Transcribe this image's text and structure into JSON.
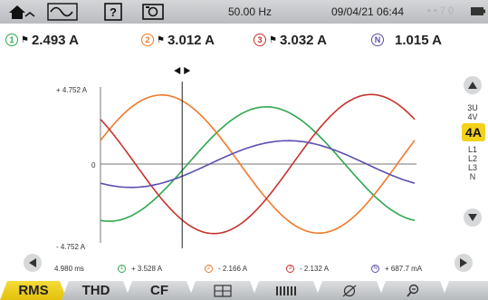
{
  "status_bar": {
    "frequency": "50.00 Hz",
    "datetime": "09/04/21 06:44",
    "faded_text": "• • 7 0",
    "icons": [
      "home-icon",
      "waveform-icon",
      "help-icon",
      "camera-icon",
      "battery-icon"
    ]
  },
  "measurements": [
    {
      "channel": "1",
      "value": "2.493 A",
      "color": "#2fa84f"
    },
    {
      "channel": "2",
      "value": "3.012 A",
      "color": "#f07a2a"
    },
    {
      "channel": "3",
      "value": "3.032 A",
      "color": "#c8322c"
    },
    {
      "channel": "N",
      "value": "1.015 A",
      "color": "#5b4fb0"
    }
  ],
  "chart": {
    "y_max_label": "+ 4.752 A",
    "y_zero_label": "0",
    "y_min_label": "- 4.752 A"
  },
  "chart_data": {
    "type": "line",
    "ylim": [
      -4.752,
      4.752
    ],
    "xlim": [
      0,
      1
    ],
    "series": [
      {
        "channel": "1",
        "color": "#2fa84f",
        "amplitude": 3.53,
        "phase_deg": 260
      },
      {
        "channel": "2",
        "color": "#f07a2a",
        "amplitude": 4.26,
        "phase_deg": 20
      },
      {
        "channel": "3",
        "color": "#c8322c",
        "amplitude": 4.29,
        "phase_deg": 140
      },
      {
        "channel": "N",
        "color": "#5b4fb0",
        "amplitude": 1.44,
        "phase_deg": 235
      }
    ],
    "cursor_fraction": 0.26
  },
  "side_menu": {
    "items_top": [
      "3U",
      "4V"
    ],
    "active": "4A",
    "items_bottom": [
      "L1",
      "L2",
      "L3",
      "N"
    ]
  },
  "cursor_readout": {
    "time": "4.980 ms",
    "values": [
      {
        "channel": "1",
        "value": "+ 3.528 A",
        "color": "#2fa84f"
      },
      {
        "channel": "2",
        "value": "- 2.166 A",
        "color": "#f07a2a"
      },
      {
        "channel": "3",
        "value": "- 2.132 A",
        "color": "#c8322c"
      },
      {
        "channel": "N",
        "value": "+ 687.7 mA",
        "color": "#5b4fb0"
      }
    ]
  },
  "tabs": {
    "rms": "RMS",
    "thd": "THD",
    "cf": "CF"
  },
  "colors": {
    "accent_yellow": "#f2d21a",
    "bar_grey": "#c6c8cb"
  }
}
